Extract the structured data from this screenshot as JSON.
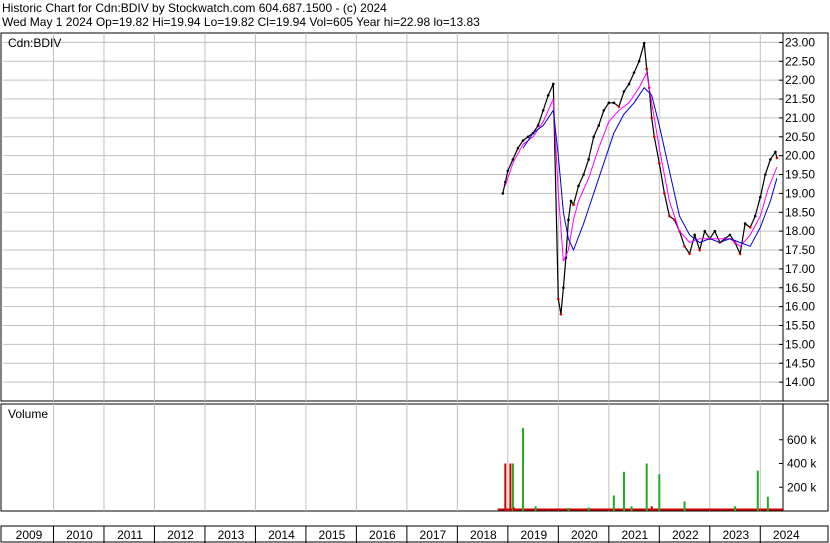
{
  "header": {
    "line1": "Historic Chart for Cdn:BDIV by Stockwatch.com 604.687.1500 - (c) 2024",
    "line2": "Wed May  1 2024   Op=19.82   Hi=19.94   Lo=19.82   Cl=19.94   Vol=605   Year hi=22.98   lo=13.83"
  },
  "colors": {
    "price": "#000000",
    "price_down": "#cc0000",
    "ma_short": "#ff00ff",
    "ma_long": "#0000cc",
    "volume_up": "#22aa22",
    "volume_down": "#cc0000",
    "grid": "#c0c0c0"
  },
  "chart_data": [
    {
      "type": "line",
      "label": "Cdn:BDIV",
      "x_range": [
        2009,
        2024.45
      ],
      "ylim": [
        13.5,
        23.25
      ],
      "y_ticks": [
        "14.00",
        "14.50",
        "15.00",
        "15.50",
        "16.00",
        "16.50",
        "17.00",
        "17.50",
        "18.00",
        "18.50",
        "19.00",
        "19.50",
        "20.00",
        "20.50",
        "21.00",
        "21.50",
        "22.00",
        "22.50",
        "23.00"
      ],
      "x_tick_labels": [
        "2009",
        "2010",
        "2011",
        "2012",
        "2013",
        "2014",
        "2015",
        "2016",
        "2017",
        "2018",
        "2019",
        "2020",
        "2021",
        "2022",
        "2023",
        "2024"
      ],
      "grid": true,
      "series": [
        {
          "role": "price",
          "x": [
            2018.9,
            2018.95,
            2019.0,
            2019.1,
            2019.2,
            2019.3,
            2019.4,
            2019.5,
            2019.6,
            2019.7,
            2019.8,
            2019.9,
            2020.0,
            2020.05,
            2020.1,
            2020.15,
            2020.2,
            2020.25,
            2020.3,
            2020.4,
            2020.5,
            2020.6,
            2020.7,
            2020.8,
            2020.9,
            2021.0,
            2021.1,
            2021.2,
            2021.3,
            2021.4,
            2021.5,
            2021.6,
            2021.7,
            2021.75,
            2021.8,
            2021.85,
            2021.9,
            2022.0,
            2022.1,
            2022.2,
            2022.3,
            2022.4,
            2022.5,
            2022.6,
            2022.7,
            2022.8,
            2022.9,
            2023.0,
            2023.1,
            2023.2,
            2023.3,
            2023.4,
            2023.5,
            2023.6,
            2023.7,
            2023.8,
            2023.9,
            2024.0,
            2024.1,
            2024.2,
            2024.3,
            2024.33
          ],
          "y": [
            19.0,
            19.3,
            19.6,
            19.9,
            20.2,
            20.4,
            20.5,
            20.6,
            20.8,
            21.2,
            21.6,
            21.9,
            16.2,
            15.8,
            16.5,
            17.3,
            18.3,
            18.8,
            18.7,
            19.2,
            19.5,
            19.9,
            20.5,
            20.8,
            21.2,
            21.4,
            21.4,
            21.3,
            21.7,
            21.9,
            22.2,
            22.5,
            22.98,
            22.3,
            21.8,
            21.0,
            20.5,
            19.8,
            19.0,
            18.4,
            18.3,
            18.0,
            17.6,
            17.4,
            17.9,
            17.5,
            18.0,
            17.8,
            18.0,
            17.7,
            17.8,
            17.9,
            17.7,
            17.4,
            18.2,
            18.1,
            18.4,
            18.9,
            19.5,
            19.9,
            20.1,
            19.94
          ]
        },
        {
          "role": "ma_short",
          "x": [
            2018.95,
            2019.1,
            2019.3,
            2019.5,
            2019.7,
            2019.9,
            2020.0,
            2020.1,
            2020.2,
            2020.3,
            2020.4,
            2020.6,
            2020.8,
            2021.0,
            2021.2,
            2021.4,
            2021.6,
            2021.75,
            2021.85,
            2022.0,
            2022.2,
            2022.4,
            2022.6,
            2022.8,
            2023.0,
            2023.2,
            2023.4,
            2023.6,
            2023.8,
            2024.0,
            2024.15,
            2024.33
          ],
          "y": [
            19.2,
            19.8,
            20.3,
            20.5,
            20.9,
            21.5,
            19.0,
            17.2,
            17.5,
            18.3,
            18.8,
            19.4,
            20.2,
            20.9,
            21.2,
            21.4,
            21.8,
            22.2,
            21.4,
            20.2,
            18.8,
            18.0,
            17.7,
            17.8,
            17.8,
            17.8,
            17.8,
            17.6,
            17.9,
            18.4,
            19.1,
            19.7
          ]
        },
        {
          "role": "ma_long",
          "x": [
            2019.3,
            2019.5,
            2019.7,
            2019.9,
            2020.0,
            2020.1,
            2020.2,
            2020.3,
            2020.5,
            2020.7,
            2020.9,
            2021.1,
            2021.3,
            2021.5,
            2021.7,
            2021.85,
            2022.0,
            2022.2,
            2022.4,
            2022.6,
            2022.8,
            2023.0,
            2023.2,
            2023.4,
            2023.6,
            2023.8,
            2024.0,
            2024.2,
            2024.33
          ],
          "y": [
            20.2,
            20.6,
            20.8,
            21.2,
            20.0,
            18.5,
            17.8,
            17.5,
            18.2,
            19.0,
            19.8,
            20.6,
            21.1,
            21.4,
            21.8,
            21.6,
            20.8,
            19.6,
            18.4,
            17.9,
            17.7,
            17.8,
            17.7,
            17.8,
            17.7,
            17.6,
            18.1,
            18.8,
            19.4
          ]
        }
      ]
    },
    {
      "type": "bar",
      "label": "Volume",
      "x_range": [
        2009,
        2024.45
      ],
      "ylim": [
        0,
        800000
      ],
      "y_ticks": [
        "200 k",
        "400 k",
        "600 k"
      ],
      "y_tick_values": [
        200000,
        400000,
        600000
      ],
      "x": [
        2018.95,
        2019.05,
        2019.1,
        2019.12,
        2019.3,
        2019.55,
        2019.8,
        2020.2,
        2020.6,
        2021.1,
        2021.3,
        2021.45,
        2021.75,
        2021.85,
        2022.0,
        2022.5,
        2023.5,
        2023.95,
        2024.15
      ],
      "values": [
        400000,
        400000,
        400000,
        30000,
        700000,
        40000,
        20000,
        25000,
        30000,
        130000,
        330000,
        40000,
        400000,
        40000,
        310000,
        80000,
        40000,
        340000,
        120000
      ],
      "colors": [
        "#cc0000",
        "#cc0000",
        "#22aa22",
        "#cc0000",
        "#22aa22",
        "#22aa22",
        "#cc0000",
        "#22aa22",
        "#22aa22",
        "#22aa22",
        "#22aa22",
        "#22aa22",
        "#22aa22",
        "#cc0000",
        "#22aa22",
        "#22aa22",
        "#22aa22",
        "#22aa22",
        "#22aa22"
      ]
    }
  ]
}
